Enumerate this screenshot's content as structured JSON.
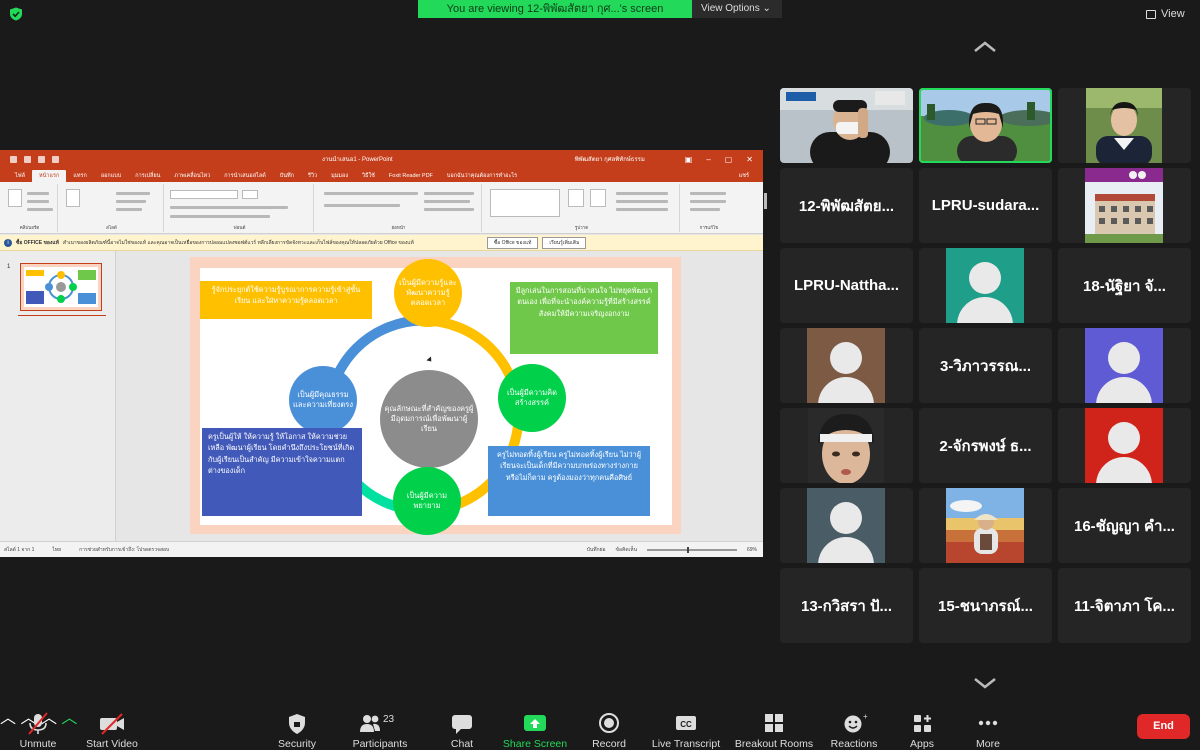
{
  "topbar": {
    "banner": "You are viewing 12-พิพัฒสัตยา กุศ...'s screen",
    "view_options": "View Options",
    "view": "View"
  },
  "ppt": {
    "doc_title": "งานนำเสนอ1 - PowerPoint",
    "account": "พิพัฒสัตยา กุศลพิทักษ์ธรรม",
    "tabs": [
      "ไฟล์",
      "หน้าแรก",
      "แทรก",
      "ออกแบบ",
      "การเปลี่ยน",
      "ภาพเคลื่อนไหว",
      "การนำเสนอสไลด์",
      "บันทึก",
      "รีวิว",
      "มุมมอง",
      "วิธีใช้",
      "Foxit Reader PDF",
      "บอกฉันว่าคุณต้องการทำอะไร",
      "แชร์"
    ],
    "active_tab": 1,
    "groups": [
      "คลิปบอร์ด",
      "สไลด์",
      "ฟอนต์",
      "ย่อหน้า",
      "รูปวาด",
      "การแก้ไข"
    ],
    "info_label": "ซื้อ OFFICE ของแท้",
    "info_message": "สำเนาของผลิตภัณฑ์นี้อาจไม่ใช่ของแท้ และคุณอาจเป็นเหยื่อของการปลอมแปลงซอฟต์แวร์ หลีกเลี่ยงการขัดจังหวะและเก็บไฟล์ของคุณให้ปลอดภัยด้วย Office ของแท้",
    "info_button_1": "ซื้อ Office ของแท้",
    "info_button_2": "เรียนรู้เพิ่มเติม",
    "slide_number": "1",
    "status_slide": "สไลด์ 1 จาก 1",
    "status_lang": "ไทย",
    "status_access": "การช่วยสำหรับการเข้าถึง: โปรดตรวจสอบ",
    "status_notes": "บันทึกย่อ",
    "status_comments": "ข้อคิดเห็น",
    "zoom": "69%"
  },
  "slide": {
    "center": "คุณลักษณะที่สำคัญของครูผู้มีอุดมการณ์เพื่อพัฒนาผู้เรียน",
    "c_top": "เป็นผู้มีความรู้และพัฒนาความรู้ตลอดเวลา",
    "c_right": "เป็นผู้มีความคิดสร้างสรรค์",
    "c_bottom": "เป็นผู้มีความพยายาม",
    "c_left": "เป็นผู้มีคุณธรรมและความเที่ยงตรง",
    "box_tl": "รู้จักประยุกต์ใช้ความรู้บูรณาการความรู้เข้าสู่ชั้นเรียน และใฝ่หาความรู้ตลอดเวลา",
    "box_tr": "มีลูกเล่นในการสอนที่น่าสนใจ ไม่หยุดพัฒนาตนเอง เพื่อที่จะนำองค์ความรู้ที่มีสร้างสรรค์สังคมให้มีความเจริญงอกงาม",
    "box_bl": "ครูเป็นผู้ให้ ให้ความรู้ ให้โอกาส ให้ความช่วยเหลือ พัฒนาผู้เรียน โดยคำนึงถึงประโยชน์ที่เกิดกับผู้เรียนเป็นสำคัญ มีความเข้าใจความแตกต่างของเด็ก",
    "box_br": "ครูไม่ทอดทิ้งผู้เรียน ครูไม่ทอดทิ้งผู้เรียน ไม่ว่าผู้เรียนจะเป็นเด็กที่มีความบกพร่องทางร่างกายหรือไม่ก็ตาม ครูต้องมองว่าทุกคนคือศิษย์"
  },
  "gallery": [
    {
      "name": "",
      "kind": "video"
    },
    {
      "name": "",
      "kind": "video",
      "speaking": true
    },
    {
      "name": "",
      "kind": "video"
    },
    {
      "name": "12-พิพัฒสัตย...",
      "kind": "name"
    },
    {
      "name": "LPRU-sudara...",
      "kind": "name"
    },
    {
      "name": "",
      "kind": "photo"
    },
    {
      "name": "LPRU-Nattha...",
      "kind": "name"
    },
    {
      "name": "",
      "kind": "avatar",
      "color": "#1f9e8a"
    },
    {
      "name": "18-นัฐิยา จั...",
      "kind": "name"
    },
    {
      "name": "",
      "kind": "avatar",
      "color": "#7d5a44"
    },
    {
      "name": "3-วิภาวรรณ...",
      "kind": "name"
    },
    {
      "name": "",
      "kind": "avatar",
      "color": "#5f5bd4"
    },
    {
      "name": "",
      "kind": "video"
    },
    {
      "name": "2-จักรพงษ์ ธ...",
      "kind": "name"
    },
    {
      "name": "",
      "kind": "avatar",
      "color": "#d0241b"
    },
    {
      "name": "",
      "kind": "avatar",
      "color": "#4a5d66"
    },
    {
      "name": "",
      "kind": "photo"
    },
    {
      "name": "16-ชัญญา คำ...",
      "kind": "name"
    },
    {
      "name": "13-กวิสรา ปั...",
      "kind": "name"
    },
    {
      "name": "15-ชนาภรณ์...",
      "kind": "name"
    },
    {
      "name": "11-จิตาภา โค...",
      "kind": "name"
    }
  ],
  "toolbar": {
    "unmute": "Unmute",
    "start_video": "Start Video",
    "security": "Security",
    "participants": "Participants",
    "participants_count": "23",
    "chat": "Chat",
    "share_screen": "Share Screen",
    "record": "Record",
    "live_transcript": "Live Transcript",
    "breakout_rooms": "Breakout Rooms",
    "reactions": "Reactions",
    "apps": "Apps",
    "more": "More",
    "end": "End"
  },
  "colors": {
    "zoom_green": "#23d959",
    "ppt_red": "#c43e1c",
    "end_red": "#e02828",
    "circle_blue": "#4a90d9",
    "circle_yellow": "#ffc000",
    "circle_green": "#00d04a",
    "circle_gray": "#8c8c8c",
    "ring_teal": "#00e0a0"
  }
}
